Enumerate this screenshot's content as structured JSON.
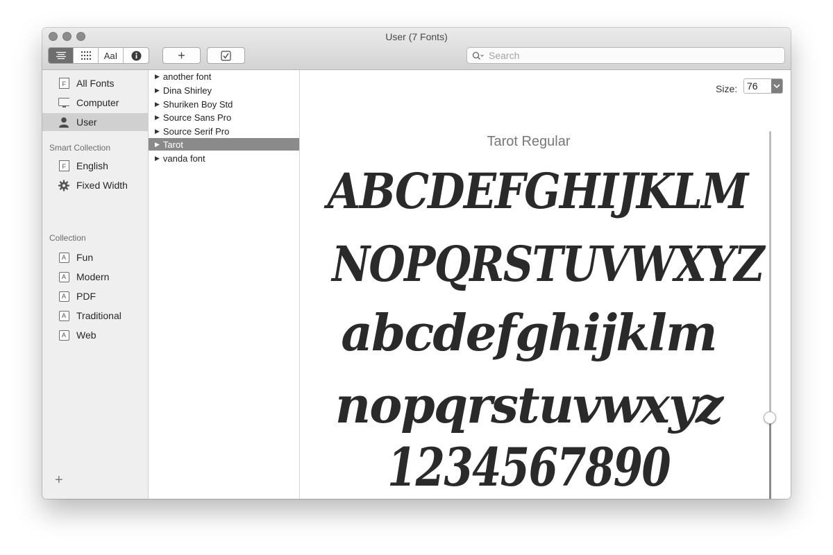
{
  "window": {
    "title": "User (7 Fonts)"
  },
  "toolbar": {
    "view_modes": [
      {
        "name": "list-view-icon",
        "active": true
      },
      {
        "name": "grid-view-icon",
        "active": false
      },
      {
        "name": "sample-view-label",
        "label": "AaI",
        "active": false
      },
      {
        "name": "info-icon",
        "active": false
      }
    ],
    "add_label": "+",
    "search": {
      "placeholder": "Search",
      "value": ""
    }
  },
  "sidebar": {
    "library_items": [
      {
        "label": "All Fonts",
        "icon": "font-file-icon"
      },
      {
        "label": "Computer",
        "icon": "computer-icon"
      },
      {
        "label": "User",
        "icon": "user-icon",
        "selected": true
      }
    ],
    "smart_collection_header": "Smart Collection",
    "smart_items": [
      {
        "label": "English",
        "icon": "font-file-icon"
      },
      {
        "label": "Fixed Width",
        "icon": "gear-icon"
      }
    ],
    "collection_header": "Collection",
    "collection_items": [
      {
        "label": "Fun",
        "icon": "collection-icon"
      },
      {
        "label": "Modern",
        "icon": "collection-icon"
      },
      {
        "label": "PDF",
        "icon": "collection-icon"
      },
      {
        "label": "Traditional",
        "icon": "collection-icon"
      },
      {
        "label": "Web",
        "icon": "collection-icon"
      }
    ],
    "add_label": "+"
  },
  "font_list": [
    {
      "label": "another font"
    },
    {
      "label": "Dina Shirley"
    },
    {
      "label": "Shuriken Boy Std"
    },
    {
      "label": "Source Sans Pro"
    },
    {
      "label": "Source Serif Pro"
    },
    {
      "label": "Tarot",
      "selected": true
    },
    {
      "label": "vanda font"
    }
  ],
  "preview": {
    "size_label": "Size:",
    "size_value": "76",
    "font_name": "Tarot Regular",
    "sample_lines": [
      "ABCDEFGHIJKLM",
      "NOPQRSTUVWXYZ",
      "abcdefghijklm",
      "nopqrstuvwxyz",
      "1234567890"
    ],
    "size_slider_level": 0.25
  },
  "colors": {
    "selection_list": "#8a8a8a",
    "selection_sidebar": "#d0d0d0",
    "segment_active": "#6e6e6e"
  }
}
